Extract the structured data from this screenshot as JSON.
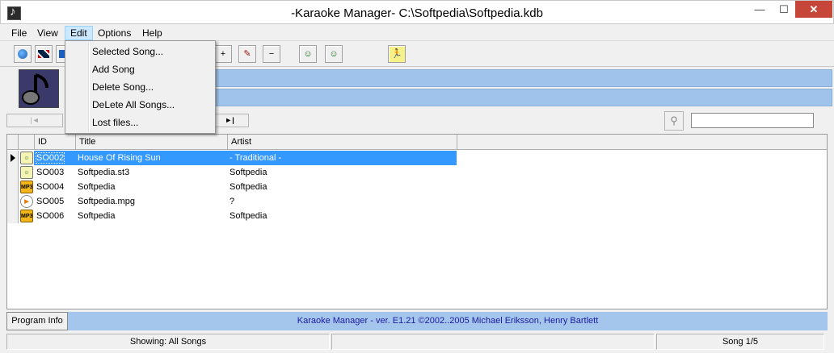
{
  "window": {
    "title": "-Karaoke Manager- C:\\Softpedia\\Softpedia.kdb",
    "minimize": "—",
    "maximize": "☐",
    "close": "✕"
  },
  "menubar": {
    "items": [
      "File",
      "View",
      "Edit",
      "Options",
      "Help"
    ],
    "active": "Edit"
  },
  "edit_menu": {
    "items": [
      "Selected Song...",
      "Add Song",
      "Delete Song...",
      "DeLete All Songs...",
      "Lost files..."
    ]
  },
  "toolbar": {
    "buttons": [
      "globe-icon",
      "uk-flag-icon",
      "swedish-flag-icon",
      "add-icon",
      "edit-icon",
      "remove-icon",
      "singer-icon",
      "singer-screen-icon",
      "exit-icon"
    ],
    "plus": "+",
    "minus": "−",
    "pen": "✎",
    "singer": "☺",
    "run": "🏃"
  },
  "search": {
    "value": ""
  },
  "grid": {
    "headers": [
      "ID",
      "Title",
      "Artist"
    ],
    "rows": [
      {
        "icon": "karaoke",
        "id": "SO002",
        "title": "House Of Rising Sun",
        "artist": "- Traditional -",
        "selected": true
      },
      {
        "icon": "karaoke",
        "id": "SO003",
        "title": "Softpedia.st3",
        "artist": "Softpedia",
        "selected": false
      },
      {
        "icon": "mp3",
        "id": "SO004",
        "title": "Softpedia",
        "artist": "Softpedia",
        "selected": false
      },
      {
        "icon": "mpg",
        "id": "SO005",
        "title": "Softpedia.mpg",
        "artist": "?",
        "selected": false
      },
      {
        "icon": "mp3",
        "id": "SO006",
        "title": "Softpedia",
        "artist": "Softpedia",
        "selected": false
      }
    ]
  },
  "footer": {
    "program_info": "Program Info",
    "credits": "Karaoke Manager - ver. E1.21 ©2002..2005 Michael Eriksson, Henry Bartlett"
  },
  "status": {
    "showing": "Showing: All Songs",
    "middle": "",
    "song_pos": "Song 1/5"
  },
  "icon_labels": {
    "mp3": "MP3",
    "karaoke": "☺",
    "mpg": "▶"
  }
}
